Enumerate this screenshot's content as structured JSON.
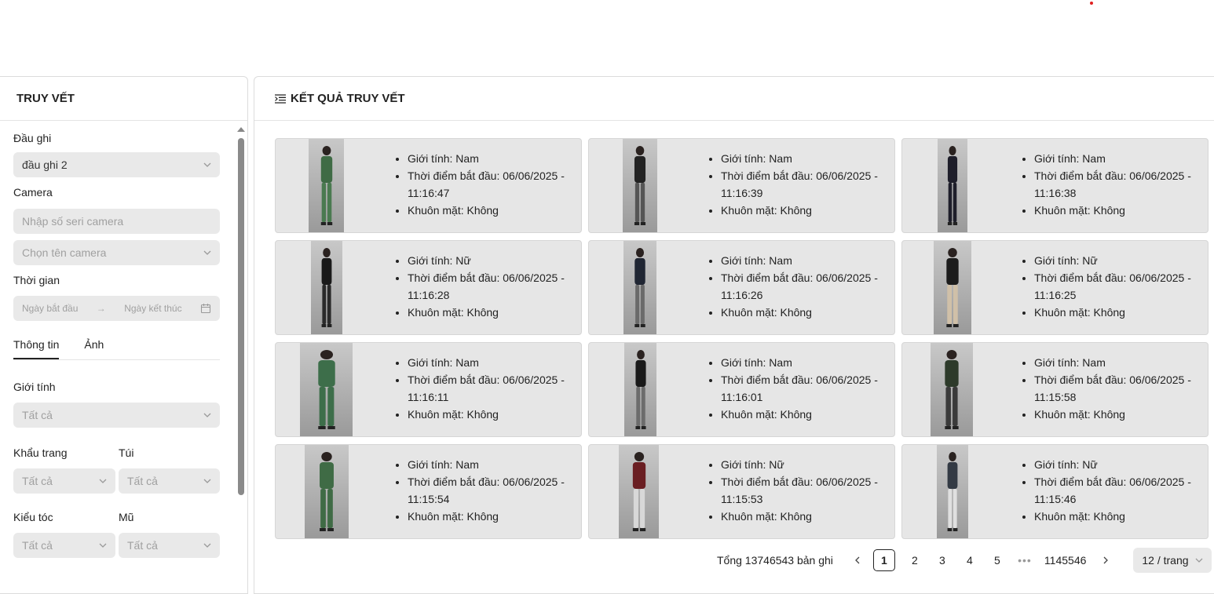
{
  "app": {
    "indicator_color": "#e02020"
  },
  "left": {
    "title": "TRUY VẾT",
    "dvr": {
      "label": "Đầu ghi",
      "value": "đầu ghi 2"
    },
    "camera": {
      "label": "Camera",
      "serial_placeholder": "Nhập số seri camera",
      "name_placeholder": "Chọn tên camera"
    },
    "time": {
      "label": "Thời gian",
      "start_placeholder": "Ngày bắt đầu",
      "end_placeholder": "Ngày kết thúc"
    },
    "tabs": [
      {
        "label": "Thông tin",
        "active": true
      },
      {
        "label": "Ảnh",
        "active": false
      }
    ],
    "gender": {
      "label": "Giới tính",
      "value": "Tất cả"
    },
    "mask": {
      "label": "Khẩu trang",
      "value": "Tất cả"
    },
    "bag": {
      "label": "Túi",
      "value": "Tất cả"
    },
    "hair": {
      "label": "Kiểu tóc",
      "value": "Tất cả"
    },
    "hat": {
      "label": "Mũ",
      "value": "Tất cả"
    }
  },
  "right": {
    "title": "KẾT QUẢ TRUY VẾT",
    "results": [
      {
        "gender": "Giới tính: Nam",
        "start": "Thời điểm bắt đầu: 06/06/2025 - 11:16:47",
        "face": "Khuôn mặt: Không",
        "shirt": "#3f6b45",
        "pants": "#4a7a50"
      },
      {
        "gender": "Giới tính: Nam",
        "start": "Thời điểm bắt đầu: 06/06/2025 - 11:16:39",
        "face": "Khuôn mặt: Không",
        "shirt": "#222222",
        "pants": "#555555"
      },
      {
        "gender": "Giới tính: Nam",
        "start": "Thời điểm bắt đầu: 06/06/2025 - 11:16:38",
        "face": "Khuôn mặt: Không",
        "shirt": "#1e1e2a",
        "pants": "#1e1e2a"
      },
      {
        "gender": "Giới tính: Nữ",
        "start": "Thời điểm bắt đầu: 06/06/2025 - 11:16:28",
        "face": "Khuôn mặt: Không",
        "shirt": "#1a1a1a",
        "pants": "#2a2a2a"
      },
      {
        "gender": "Giới tính: Nam",
        "start": "Thời điểm bắt đầu: 06/06/2025 - 11:16:26",
        "face": "Khuôn mặt: Không",
        "shirt": "#202633",
        "pants": "#6a6a6a"
      },
      {
        "gender": "Giới tính: Nữ",
        "start": "Thời điểm bắt đầu: 06/06/2025 - 11:16:25",
        "face": "Khuôn mặt: Không",
        "shirt": "#1c1c1c",
        "pants": "#d0c0a8"
      },
      {
        "gender": "Giới tính: Nam",
        "start": "Thời điểm bắt đầu: 06/06/2025 - 11:16:11",
        "face": "Khuôn mặt: Không",
        "shirt": "#3d6e4a",
        "pants": "#3d6e4a"
      },
      {
        "gender": "Giới tính: Nam",
        "start": "Thời điểm bắt đầu: 06/06/2025 - 11:16:01",
        "face": "Khuôn mặt: Không",
        "shirt": "#1a1a1a",
        "pants": "#6c6c6c"
      },
      {
        "gender": "Giới tính: Nam",
        "start": "Thời điểm bắt đầu: 06/06/2025 - 11:15:58",
        "face": "Khuôn mặt: Không",
        "shirt": "#2d3a2a",
        "pants": "#3a3a3a"
      },
      {
        "gender": "Giới tính: Nam",
        "start": "Thời điểm bắt đầu: 06/06/2025 - 11:15:54",
        "face": "Khuôn mặt: Không",
        "shirt": "#3f6b45",
        "pants": "#3f6b45"
      },
      {
        "gender": "Giới tính: Nữ",
        "start": "Thời điểm bắt đầu: 06/06/2025 - 11:15:53",
        "face": "Khuôn mặt: Không",
        "shirt": "#6a1e22",
        "pants": "#d8d8d8"
      },
      {
        "gender": "Giới tính: Nữ",
        "start": "Thời điểm bắt đầu: 06/06/2025 - 11:15:46",
        "face": "Khuôn mặt: Không",
        "shirt": "#333a44",
        "pants": "#e0e0e0"
      }
    ],
    "pagination": {
      "total": "Tổng 13746543 bản ghi",
      "pages": [
        "1",
        "2",
        "3",
        "4",
        "5"
      ],
      "current": "1",
      "ellipsis": "•••",
      "last": "1145546",
      "page_size": "12 / trang"
    }
  }
}
